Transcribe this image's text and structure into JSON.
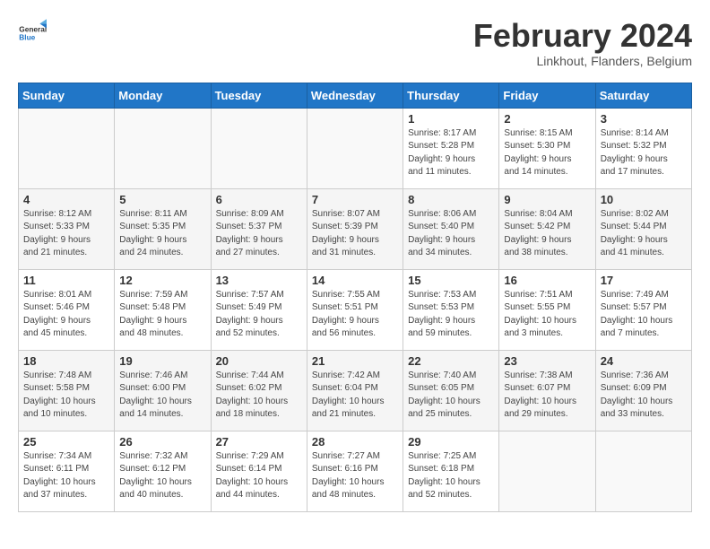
{
  "header": {
    "logo_general": "General",
    "logo_blue": "Blue",
    "month_title": "February 2024",
    "subtitle": "Linkhout, Flanders, Belgium"
  },
  "days_of_week": [
    "Sunday",
    "Monday",
    "Tuesday",
    "Wednesday",
    "Thursday",
    "Friday",
    "Saturday"
  ],
  "weeks": [
    [
      {
        "day": "",
        "info": ""
      },
      {
        "day": "",
        "info": ""
      },
      {
        "day": "",
        "info": ""
      },
      {
        "day": "",
        "info": ""
      },
      {
        "day": "1",
        "info": "Sunrise: 8:17 AM\nSunset: 5:28 PM\nDaylight: 9 hours\nand 11 minutes."
      },
      {
        "day": "2",
        "info": "Sunrise: 8:15 AM\nSunset: 5:30 PM\nDaylight: 9 hours\nand 14 minutes."
      },
      {
        "day": "3",
        "info": "Sunrise: 8:14 AM\nSunset: 5:32 PM\nDaylight: 9 hours\nand 17 minutes."
      }
    ],
    [
      {
        "day": "4",
        "info": "Sunrise: 8:12 AM\nSunset: 5:33 PM\nDaylight: 9 hours\nand 21 minutes."
      },
      {
        "day": "5",
        "info": "Sunrise: 8:11 AM\nSunset: 5:35 PM\nDaylight: 9 hours\nand 24 minutes."
      },
      {
        "day": "6",
        "info": "Sunrise: 8:09 AM\nSunset: 5:37 PM\nDaylight: 9 hours\nand 27 minutes."
      },
      {
        "day": "7",
        "info": "Sunrise: 8:07 AM\nSunset: 5:39 PM\nDaylight: 9 hours\nand 31 minutes."
      },
      {
        "day": "8",
        "info": "Sunrise: 8:06 AM\nSunset: 5:40 PM\nDaylight: 9 hours\nand 34 minutes."
      },
      {
        "day": "9",
        "info": "Sunrise: 8:04 AM\nSunset: 5:42 PM\nDaylight: 9 hours\nand 38 minutes."
      },
      {
        "day": "10",
        "info": "Sunrise: 8:02 AM\nSunset: 5:44 PM\nDaylight: 9 hours\nand 41 minutes."
      }
    ],
    [
      {
        "day": "11",
        "info": "Sunrise: 8:01 AM\nSunset: 5:46 PM\nDaylight: 9 hours\nand 45 minutes."
      },
      {
        "day": "12",
        "info": "Sunrise: 7:59 AM\nSunset: 5:48 PM\nDaylight: 9 hours\nand 48 minutes."
      },
      {
        "day": "13",
        "info": "Sunrise: 7:57 AM\nSunset: 5:49 PM\nDaylight: 9 hours\nand 52 minutes."
      },
      {
        "day": "14",
        "info": "Sunrise: 7:55 AM\nSunset: 5:51 PM\nDaylight: 9 hours\nand 56 minutes."
      },
      {
        "day": "15",
        "info": "Sunrise: 7:53 AM\nSunset: 5:53 PM\nDaylight: 9 hours\nand 59 minutes."
      },
      {
        "day": "16",
        "info": "Sunrise: 7:51 AM\nSunset: 5:55 PM\nDaylight: 10 hours\nand 3 minutes."
      },
      {
        "day": "17",
        "info": "Sunrise: 7:49 AM\nSunset: 5:57 PM\nDaylight: 10 hours\nand 7 minutes."
      }
    ],
    [
      {
        "day": "18",
        "info": "Sunrise: 7:48 AM\nSunset: 5:58 PM\nDaylight: 10 hours\nand 10 minutes."
      },
      {
        "day": "19",
        "info": "Sunrise: 7:46 AM\nSunset: 6:00 PM\nDaylight: 10 hours\nand 14 minutes."
      },
      {
        "day": "20",
        "info": "Sunrise: 7:44 AM\nSunset: 6:02 PM\nDaylight: 10 hours\nand 18 minutes."
      },
      {
        "day": "21",
        "info": "Sunrise: 7:42 AM\nSunset: 6:04 PM\nDaylight: 10 hours\nand 21 minutes."
      },
      {
        "day": "22",
        "info": "Sunrise: 7:40 AM\nSunset: 6:05 PM\nDaylight: 10 hours\nand 25 minutes."
      },
      {
        "day": "23",
        "info": "Sunrise: 7:38 AM\nSunset: 6:07 PM\nDaylight: 10 hours\nand 29 minutes."
      },
      {
        "day": "24",
        "info": "Sunrise: 7:36 AM\nSunset: 6:09 PM\nDaylight: 10 hours\nand 33 minutes."
      }
    ],
    [
      {
        "day": "25",
        "info": "Sunrise: 7:34 AM\nSunset: 6:11 PM\nDaylight: 10 hours\nand 37 minutes."
      },
      {
        "day": "26",
        "info": "Sunrise: 7:32 AM\nSunset: 6:12 PM\nDaylight: 10 hours\nand 40 minutes."
      },
      {
        "day": "27",
        "info": "Sunrise: 7:29 AM\nSunset: 6:14 PM\nDaylight: 10 hours\nand 44 minutes."
      },
      {
        "day": "28",
        "info": "Sunrise: 7:27 AM\nSunset: 6:16 PM\nDaylight: 10 hours\nand 48 minutes."
      },
      {
        "day": "29",
        "info": "Sunrise: 7:25 AM\nSunset: 6:18 PM\nDaylight: 10 hours\nand 52 minutes."
      },
      {
        "day": "",
        "info": ""
      },
      {
        "day": "",
        "info": ""
      }
    ]
  ]
}
